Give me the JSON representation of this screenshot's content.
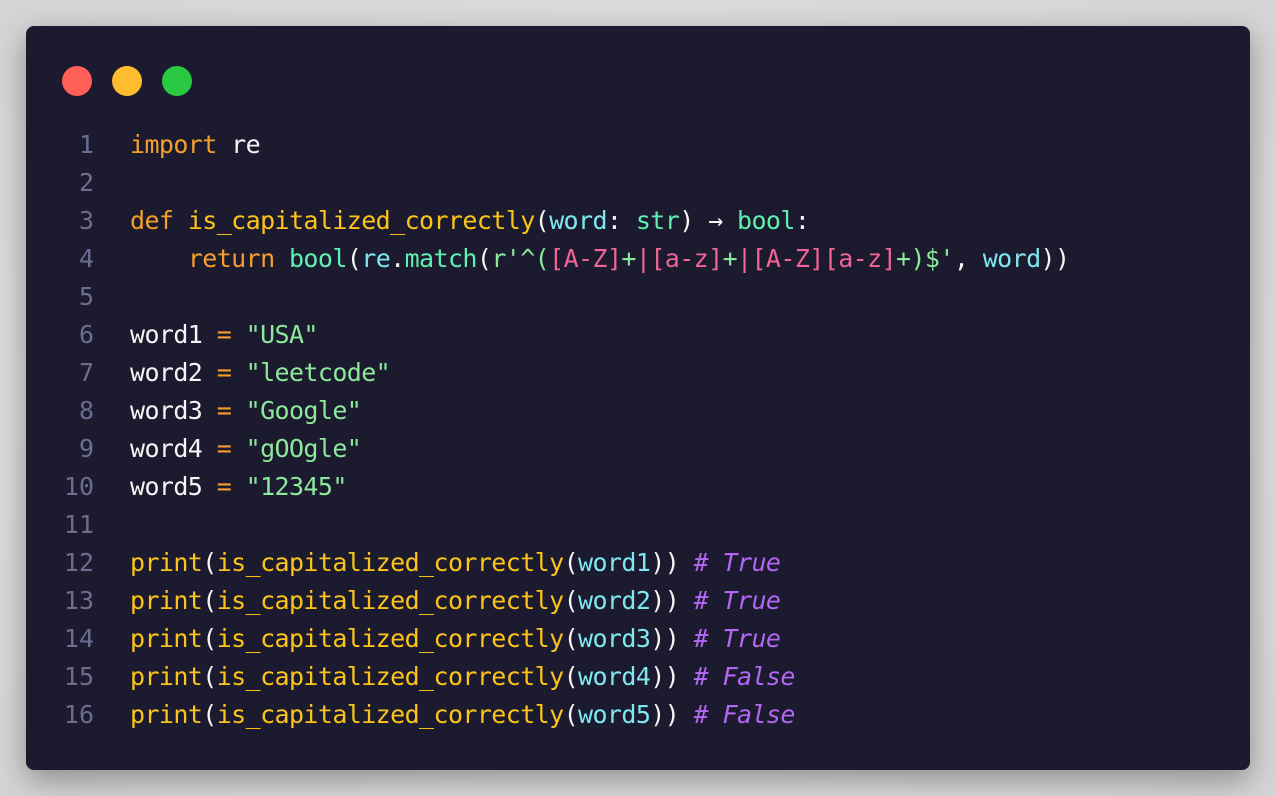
{
  "window": {
    "controls": [
      "close",
      "minimize",
      "maximize"
    ]
  },
  "code": {
    "language": "python",
    "lines": [
      {
        "n": "1",
        "tokens": [
          [
            "kw",
            "import"
          ],
          [
            "pl",
            " re"
          ]
        ]
      },
      {
        "n": "2",
        "tokens": []
      },
      {
        "n": "3",
        "tokens": [
          [
            "kw",
            "def"
          ],
          [
            "pl",
            " "
          ],
          [
            "fn",
            "is_capitalized_correctly"
          ],
          [
            "pn",
            "("
          ],
          [
            "var",
            "word"
          ],
          [
            "pl",
            ": "
          ],
          [
            "ty",
            "str"
          ],
          [
            "pn",
            ")"
          ],
          [
            "pl",
            " → "
          ],
          [
            "ty",
            "bool"
          ],
          [
            "pl",
            ":"
          ]
        ]
      },
      {
        "n": "4",
        "tokens": [
          [
            "pl",
            "    "
          ],
          [
            "kw",
            "return"
          ],
          [
            "pl",
            " "
          ],
          [
            "bi",
            "bool"
          ],
          [
            "pn",
            "("
          ],
          [
            "var",
            "re"
          ],
          [
            "pl",
            "."
          ],
          [
            "bi",
            "match"
          ],
          [
            "pn",
            "("
          ],
          [
            "str",
            "r'^("
          ],
          [
            "rx",
            "[A-Z]"
          ],
          [
            "str",
            "+"
          ],
          [
            "rx",
            "|"
          ],
          [
            "rx",
            "[a-z]"
          ],
          [
            "str",
            "+"
          ],
          [
            "rx",
            "|"
          ],
          [
            "rx",
            "[A-Z][a-z]"
          ],
          [
            "str",
            "+)$'"
          ],
          [
            "pl",
            ", "
          ],
          [
            "var",
            "word"
          ],
          [
            "pn",
            "))"
          ]
        ]
      },
      {
        "n": "5",
        "tokens": []
      },
      {
        "n": "6",
        "tokens": [
          [
            "pl",
            "word1 "
          ],
          [
            "op",
            "="
          ],
          [
            "pl",
            " "
          ],
          [
            "str",
            "\"USA\""
          ]
        ]
      },
      {
        "n": "7",
        "tokens": [
          [
            "pl",
            "word2 "
          ],
          [
            "op",
            "="
          ],
          [
            "pl",
            " "
          ],
          [
            "str",
            "\"leetcode\""
          ]
        ]
      },
      {
        "n": "8",
        "tokens": [
          [
            "pl",
            "word3 "
          ],
          [
            "op",
            "="
          ],
          [
            "pl",
            " "
          ],
          [
            "str",
            "\"Google\""
          ]
        ]
      },
      {
        "n": "9",
        "tokens": [
          [
            "pl",
            "word4 "
          ],
          [
            "op",
            "="
          ],
          [
            "pl",
            " "
          ],
          [
            "str",
            "\"gOOgle\""
          ]
        ]
      },
      {
        "n": "10",
        "tokens": [
          [
            "pl",
            "word5 "
          ],
          [
            "op",
            "="
          ],
          [
            "pl",
            " "
          ],
          [
            "str",
            "\"12345\""
          ]
        ]
      },
      {
        "n": "11",
        "tokens": []
      },
      {
        "n": "12",
        "tokens": [
          [
            "fn",
            "print"
          ],
          [
            "pn",
            "("
          ],
          [
            "fn",
            "is_capitalized_correctly"
          ],
          [
            "pn",
            "("
          ],
          [
            "var",
            "word1"
          ],
          [
            "pn",
            "))"
          ],
          [
            "pl",
            " "
          ],
          [
            "cm",
            "# True"
          ]
        ]
      },
      {
        "n": "13",
        "tokens": [
          [
            "fn",
            "print"
          ],
          [
            "pn",
            "("
          ],
          [
            "fn",
            "is_capitalized_correctly"
          ],
          [
            "pn",
            "("
          ],
          [
            "var",
            "word2"
          ],
          [
            "pn",
            "))"
          ],
          [
            "pl",
            " "
          ],
          [
            "cm",
            "# True"
          ]
        ]
      },
      {
        "n": "14",
        "tokens": [
          [
            "fn",
            "print"
          ],
          [
            "pn",
            "("
          ],
          [
            "fn",
            "is_capitalized_correctly"
          ],
          [
            "pn",
            "("
          ],
          [
            "var",
            "word3"
          ],
          [
            "pn",
            "))"
          ],
          [
            "pl",
            " "
          ],
          [
            "cm",
            "# True"
          ]
        ]
      },
      {
        "n": "15",
        "tokens": [
          [
            "fn",
            "print"
          ],
          [
            "pn",
            "("
          ],
          [
            "fn",
            "is_capitalized_correctly"
          ],
          [
            "pn",
            "("
          ],
          [
            "var",
            "word4"
          ],
          [
            "pn",
            "))"
          ],
          [
            "pl",
            " "
          ],
          [
            "cm",
            "# False"
          ]
        ]
      },
      {
        "n": "16",
        "tokens": [
          [
            "fn",
            "print"
          ],
          [
            "pn",
            "("
          ],
          [
            "fn",
            "is_capitalized_correctly"
          ],
          [
            "pn",
            "("
          ],
          [
            "var",
            "word5"
          ],
          [
            "pn",
            "))"
          ],
          [
            "pl",
            " "
          ],
          [
            "cm",
            "# False"
          ]
        ]
      }
    ]
  },
  "colors": {
    "background": "#1b1a2e",
    "close": "#ff5f57",
    "minimize": "#febc2e",
    "maximize": "#28c840",
    "keyword": "#f59e2c",
    "function": "#fcc419",
    "builtin": "#5ff0b0",
    "variable": "#7fe7f0",
    "string": "#8ce99a",
    "regex": "#f06595",
    "comment": "#b466f5",
    "line_number": "#6e6c90"
  }
}
